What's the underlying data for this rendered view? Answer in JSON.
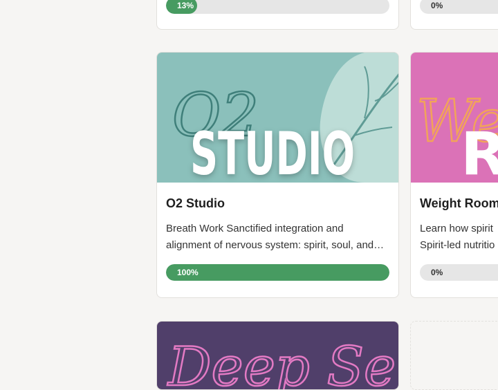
{
  "courses_top": [
    {
      "progress": 13,
      "progress_label": "13%"
    },
    {
      "progress": 0,
      "progress_label": "0%"
    }
  ],
  "courses": [
    {
      "thumb_script": "O2",
      "thumb_title": "STUDIO",
      "title": "O2 Studio",
      "description": "Breath Work Sanctified integration and alignment of nervous system: spirit, soul, and body",
      "progress": 100,
      "progress_label": "100%"
    },
    {
      "thumb_script": "Wei",
      "thumb_title": "RO",
      "title": "Weight Room",
      "description_line1": "Learn how spirit",
      "description_line2": "Spirit-led nutritio",
      "progress": 0,
      "progress_label": "0%"
    }
  ],
  "courses_bottom": [
    {
      "thumb_script": "Deep Serve"
    }
  ],
  "colors": {
    "progress_fill": "#479b61",
    "progress_track": "#e6e6e6",
    "o2_bg": "#8bc0bb",
    "weight_bg": "#db72b7",
    "deep_bg": "#503f6a"
  }
}
